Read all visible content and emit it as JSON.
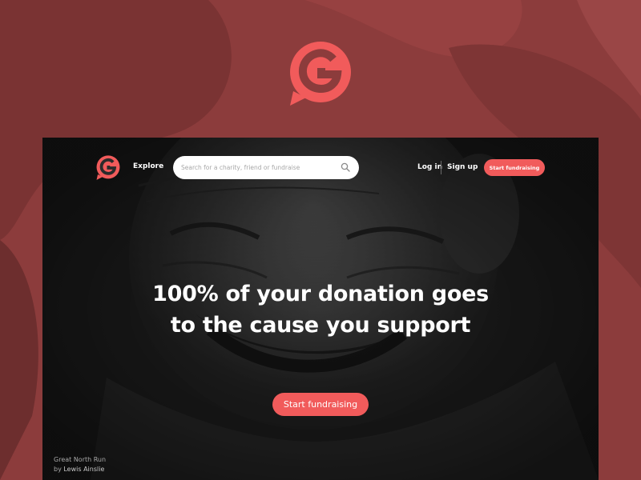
{
  "colors": {
    "outer_background": "#8c3c3c",
    "accent": "#f15b5b",
    "frame_background": "#262626",
    "text_primary": "#ffffff"
  },
  "header": {
    "explore_label": "Explore",
    "login_label": "Log in",
    "signup_label": "Sign up",
    "cta_label": "Start fundraising"
  },
  "search": {
    "placeholder": "Search for a charity, friend or fundraise",
    "value": "",
    "icon": "search-icon"
  },
  "hero": {
    "headline_line1": "100% of your donation goes",
    "headline_line2": "to the cause you support",
    "cta_label": "Start fundraising"
  },
  "photo_credit": {
    "title": "Great North Run",
    "by_prefix": "by ",
    "author": "Lewis Ainslie"
  }
}
